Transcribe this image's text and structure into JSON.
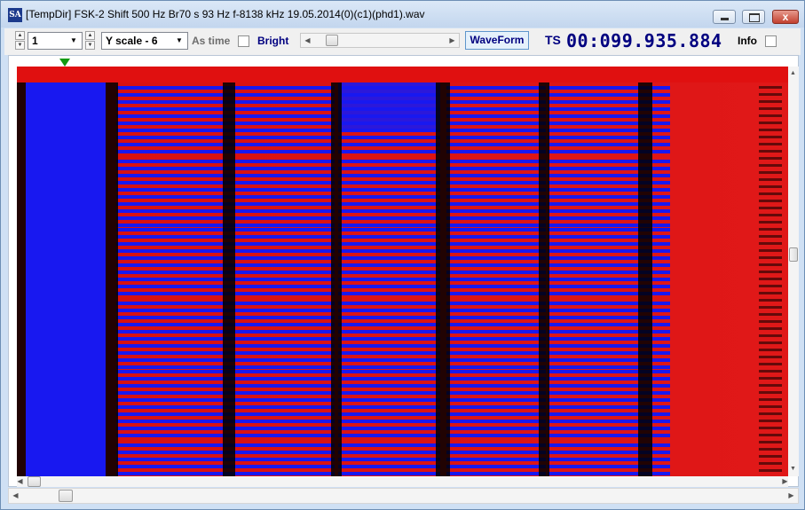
{
  "window": {
    "app_icon": "SA",
    "title": "[TempDir] FSK-2 Shift 500 Hz Br70 s 93 Hz f-8138 kHz 19.05.2014(0)(c1)(phd1).wav",
    "close_glyph": "x"
  },
  "toolbar": {
    "channel_value": "1",
    "yscale_value": "Y scale - 6",
    "as_time_label": "As time",
    "as_time_checked": false,
    "bright_label": "Bright",
    "bright_checked": false,
    "waveform_label": "WaveForm",
    "ts_label": "TS",
    "ts_value": "00:099.935.884",
    "info_label": "Info",
    "info_checked": false
  },
  "icons": {
    "up_arrow": "▲",
    "down_arrow": "▼",
    "left_arrow": "◀",
    "right_arrow": "▶"
  },
  "colors": {
    "signal_high": "#e01010",
    "signal_low": "#1818f0",
    "transition": "#000000",
    "marker": "#129a12",
    "accent_text": "#000080"
  }
}
